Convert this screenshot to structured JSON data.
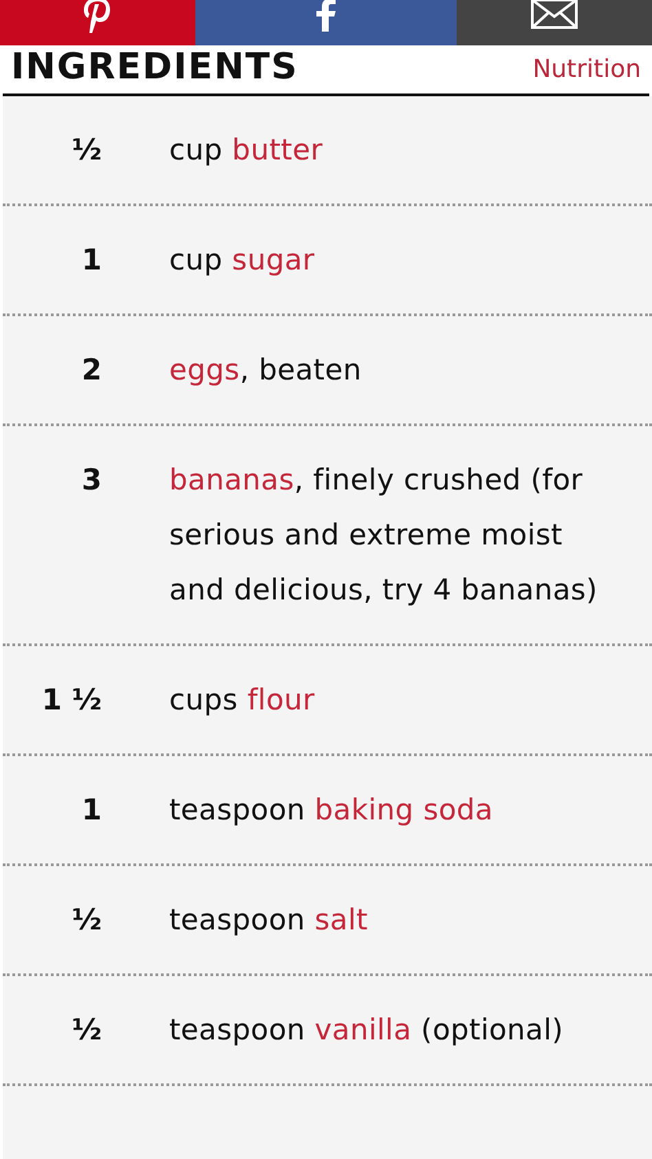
{
  "share_bar": [
    {
      "kind": "pinterest"
    },
    {
      "kind": "facebook"
    },
    {
      "kind": "email"
    }
  ],
  "heading": "INGREDIENTS",
  "nutrition_link": "Nutrition",
  "ingredients": [
    {
      "amount": "½",
      "before": "cup ",
      "ingredient": "butter"
    },
    {
      "amount": "1",
      "before": "cup ",
      "ingredient": "sugar"
    },
    {
      "amount": "2",
      "ingredient": "eggs",
      "after": ", beaten"
    },
    {
      "amount": "3",
      "ingredient": "bananas",
      "after": ", finely crushed (for serious and extreme moist and delicious, try 4 bananas)"
    },
    {
      "amount": "1 ½",
      "before": "cups ",
      "ingredient": "flour"
    },
    {
      "amount": "1",
      "before": "teaspoon ",
      "ingredient": "baking soda"
    },
    {
      "amount": "½",
      "before": "teaspoon ",
      "ingredient": "salt"
    },
    {
      "amount": "½",
      "before": "teaspoon ",
      "ingredient": "vanilla",
      "after": " (optional)"
    }
  ]
}
